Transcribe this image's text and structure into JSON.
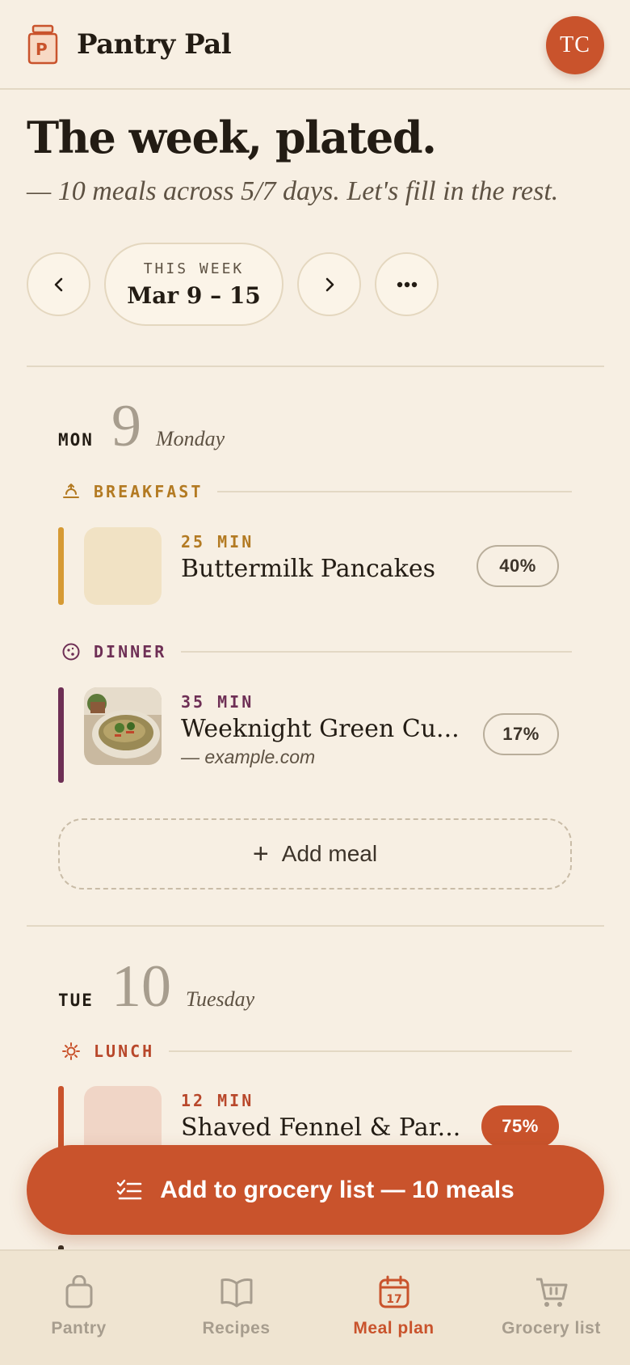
{
  "header": {
    "app_name": "Pantry Pal",
    "avatar_initials": "TC"
  },
  "page": {
    "title": "The week, plated.",
    "subtitle": "— 10 meals across 5/7 days. Let's fill in the rest."
  },
  "week_nav": {
    "label": "THIS WEEK",
    "range": "Mar 9 – 15",
    "more": "•••"
  },
  "days": [
    {
      "abbr": "MON",
      "num": "9",
      "name": "Monday",
      "meals": [
        {
          "type": "BREAKFAST",
          "type_icon": "sunrise-icon",
          "time": "25 MIN",
          "name": "Buttermilk Pancakes",
          "source": "",
          "percent": "40%",
          "accent": "#d69a34"
        },
        {
          "type": "DINNER",
          "type_icon": "moon-icon",
          "time": "35 MIN",
          "name": "Weeknight Green Cu...",
          "source": "— example.com",
          "percent": "17%",
          "accent": "#6e2f55"
        }
      ],
      "add_label": "Add meal"
    },
    {
      "abbr": "TUE",
      "num": "10",
      "name": "Tuesday",
      "meals": [
        {
          "type": "LUNCH",
          "type_icon": "sun-icon",
          "time": "12 MIN",
          "name": "Shaved Fennel & Par...",
          "source": "",
          "percent": "75%",
          "accent": "#c9532c"
        }
      ]
    }
  ],
  "cta": {
    "label": "Add to grocery list — 10 meals"
  },
  "tabs": [
    {
      "label": "Pantry",
      "icon": "bag-icon"
    },
    {
      "label": "Recipes",
      "icon": "book-icon"
    },
    {
      "label": "Meal plan",
      "icon": "calendar-icon",
      "badge": "17",
      "active": true
    },
    {
      "label": "Grocery list",
      "icon": "cart-icon"
    }
  ],
  "colors": {
    "background": "#f7efe3",
    "accent": "#c9532c",
    "breakfast": "#d69a34",
    "dinner": "#6e2f55",
    "lunch": "#c9532c"
  }
}
